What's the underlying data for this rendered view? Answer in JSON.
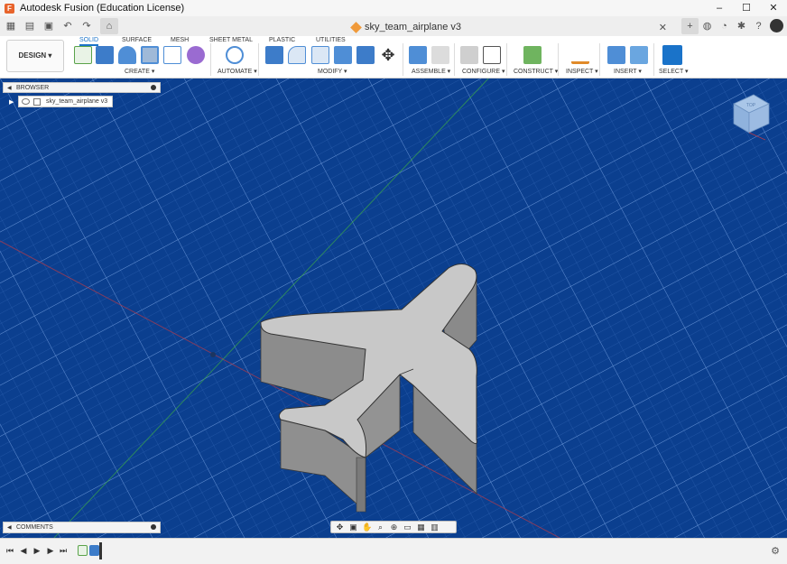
{
  "window": {
    "title": "Autodesk Fusion (Education License)",
    "controls": [
      "–",
      "☐",
      "✕"
    ]
  },
  "qbar": {
    "doc_tab": "sky_team_airplane v3",
    "doc_close": "✕"
  },
  "toolbar": {
    "design_button": "DESIGN ▾",
    "tabs": [
      "SOLID",
      "SURFACE",
      "MESH",
      "SHEET METAL",
      "PLASTIC",
      "UTILITIES"
    ],
    "groups": {
      "create": "CREATE ▾",
      "automate": "AUTOMATE ▾",
      "modify": "MODIFY ▾",
      "assemble": "ASSEMBLE ▾",
      "configure": "CONFIGURE ▾",
      "construct": "CONSTRUCT ▾",
      "inspect": "INSPECT ▾",
      "insert": "INSERT ▾",
      "select": "SELECT ▾"
    }
  },
  "browser": {
    "title": "BROWSER",
    "root_item": "sky_team_airplane v3"
  },
  "viewcube": {
    "face": "TOP"
  },
  "comments": {
    "title": "COMMENTS"
  },
  "colors": {
    "viewport_bg": "#0b3f8f",
    "accent": "#1a73c9",
    "model_face": "#c8c8c8",
    "model_side": "#8a8a8a"
  }
}
